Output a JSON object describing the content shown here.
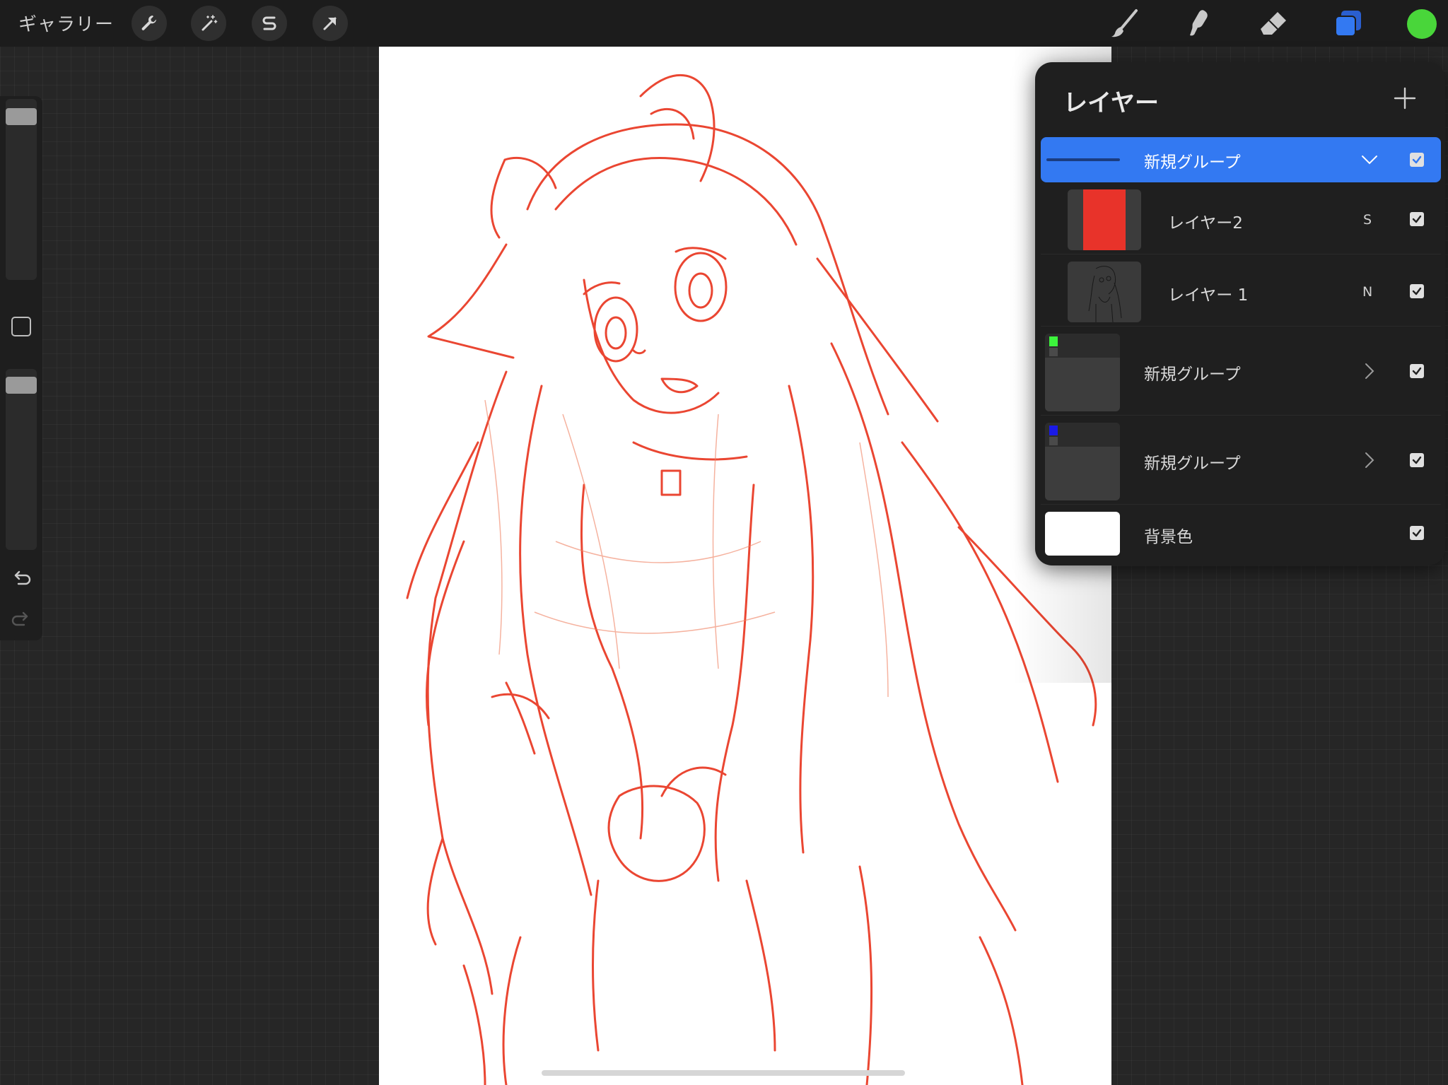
{
  "topbar": {
    "gallery_label": "ギャラリー",
    "tools": [
      "wrench-icon",
      "magic-wand-icon",
      "selection-s-icon",
      "move-arrow-icon"
    ],
    "right_tools": [
      "brush-icon",
      "smudge-icon",
      "eraser-icon",
      "layers-icon"
    ],
    "current_color": "#49d63a"
  },
  "sidebar": {
    "brush_size": 0.05,
    "opacity": 0.04
  },
  "layers": {
    "title": "レイヤー",
    "rows": [
      {
        "name": "新規グループ",
        "blend": "",
        "expanded": true,
        "visible": true
      },
      {
        "name": "レイヤー2",
        "blend": "S",
        "visible": true,
        "thumb_color": "#e8332a"
      },
      {
        "name": "レイヤー 1",
        "blend": "N",
        "visible": true
      },
      {
        "name": "新規グループ",
        "blend": "",
        "expanded": false,
        "visible": true,
        "thumb_color": "#3cf43c"
      },
      {
        "name": "新規グループ",
        "blend": "",
        "expanded": false,
        "visible": true,
        "thumb_color": "#1a1ae6"
      },
      {
        "name": "背景色",
        "blend": "",
        "visible": true,
        "thumb_color": "#ffffff"
      }
    ]
  },
  "colors": {
    "accent": "#3379f2",
    "sketch": "#e8331c"
  }
}
